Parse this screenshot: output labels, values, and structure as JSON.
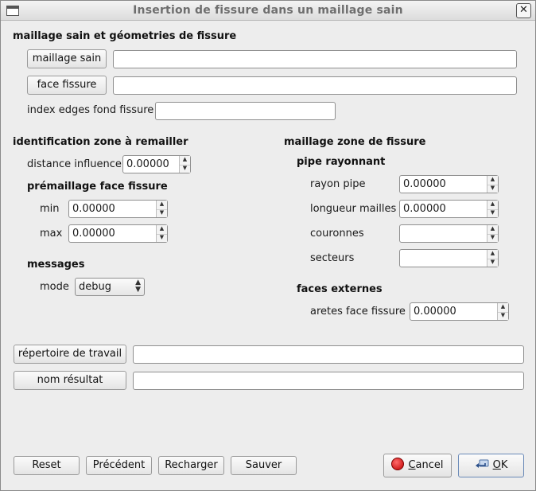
{
  "window": {
    "title": "Insertion de fissure dans un maillage sain"
  },
  "section_geom": {
    "title": "maillage sain et géometries de fissure",
    "maillage_sain_button": "maillage sain",
    "maillage_sain_value": "",
    "face_fissure_button": "face fissure",
    "face_fissure_value": "",
    "index_edges_label": "index edges fond fissure",
    "index_edges_value": ""
  },
  "section_ident": {
    "title": "identification zone à remailler",
    "distance_influence_label": "distance influence",
    "distance_influence_value": "0.00000",
    "premaillage_title": "prémaillage face fissure",
    "min_label": "min",
    "min_value": "0.00000",
    "max_label": "max",
    "max_value": "0.00000",
    "messages_title": "messages",
    "mode_label": "mode",
    "mode_value": "debug"
  },
  "section_zone": {
    "title": "maillage zone de fissure",
    "pipe_title": "pipe rayonnant",
    "rayon_pipe_label": "rayon pipe",
    "rayon_pipe_value": "0.00000",
    "longueur_mailles_label": "longueur mailles",
    "longueur_mailles_value": "0.00000",
    "couronnes_label": "couronnes",
    "couronnes_value": "",
    "secteurs_label": "secteurs",
    "secteurs_value": "",
    "faces_externes_title": "faces externes",
    "aretes_label": "aretes face fissure",
    "aretes_value": "0.00000"
  },
  "work": {
    "repertoire_button": "répertoire de travail",
    "repertoire_value": "",
    "nom_resultat_button": "nom résultat",
    "nom_resultat_value": ""
  },
  "footer": {
    "reset": "Reset",
    "precedent": "Précédent",
    "recharger": "Recharger",
    "sauver": "Sauver",
    "cancel_first": "C",
    "cancel_rest": "ancel",
    "ok_first": "O",
    "ok_rest": "K"
  },
  "icons": {
    "cancel": "stop-red-circle-icon",
    "ok": "enter-arrow-icon"
  }
}
